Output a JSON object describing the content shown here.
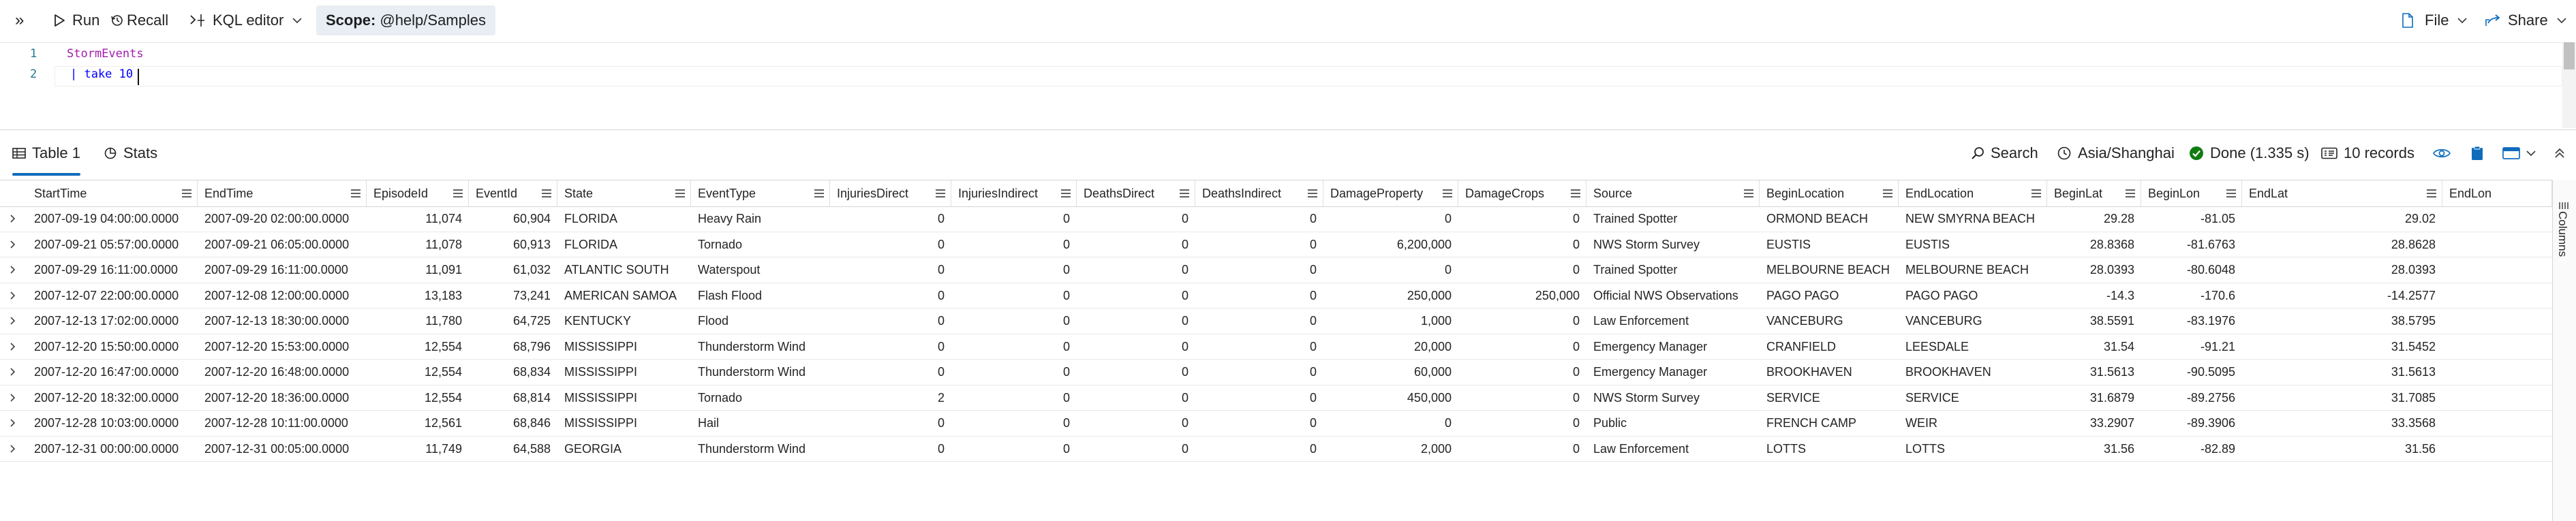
{
  "toolbar": {
    "expand_glyph": "»",
    "run_label": "Run",
    "recall_label": "Recall",
    "editor_label": "KQL editor",
    "scope_label": "Scope:",
    "scope_value": "@help/Samples",
    "file_label": "File",
    "share_label": "Share"
  },
  "editor": {
    "lines": [
      {
        "number": "1",
        "text": "StormEvents"
      },
      {
        "number": "2",
        "text": "| take 10"
      }
    ]
  },
  "results": {
    "tabs": [
      {
        "label": "Table 1",
        "active": true
      },
      {
        "label": "Stats",
        "active": false
      }
    ],
    "search_label": "Search",
    "timezone_label": "Asia/Shanghai",
    "status_label": "Done (1.335 s)",
    "records_label": "10 records",
    "side_panel_label": "Columns"
  },
  "table": {
    "columns": [
      "StartTime",
      "EndTime",
      "EpisodeId",
      "EventId",
      "State",
      "EventType",
      "InjuriesDirect",
      "InjuriesIndirect",
      "DeathsDirect",
      "DeathsIndirect",
      "DamageProperty",
      "DamageCrops",
      "Source",
      "BeginLocation",
      "EndLocation",
      "BeginLat",
      "BeginLon",
      "EndLat",
      "EndLon"
    ],
    "rows": [
      [
        "2007-09-19 04:00:00.0000",
        "2007-09-20 02:00:00.0000",
        "11,074",
        "60,904",
        "FLORIDA",
        "Heavy Rain",
        "0",
        "0",
        "0",
        "0",
        "0",
        "0",
        "Trained Spotter",
        "ORMOND BEACH",
        "NEW SMYRNA BEACH",
        "29.28",
        "-81.05",
        "29.02",
        ""
      ],
      [
        "2007-09-21 05:57:00.0000",
        "2007-09-21 06:05:00.0000",
        "11,078",
        "60,913",
        "FLORIDA",
        "Tornado",
        "0",
        "0",
        "0",
        "0",
        "6,200,000",
        "0",
        "NWS Storm Survey",
        "EUSTIS",
        "EUSTIS",
        "28.8368",
        "-81.6763",
        "28.8628",
        ""
      ],
      [
        "2007-09-29 16:11:00.0000",
        "2007-09-29 16:11:00.0000",
        "11,091",
        "61,032",
        "ATLANTIC SOUTH",
        "Waterspout",
        "0",
        "0",
        "0",
        "0",
        "0",
        "0",
        "Trained Spotter",
        "MELBOURNE BEACH",
        "MELBOURNE BEACH",
        "28.0393",
        "-80.6048",
        "28.0393",
        ""
      ],
      [
        "2007-12-07 22:00:00.0000",
        "2007-12-08 12:00:00.0000",
        "13,183",
        "73,241",
        "AMERICAN SAMOA",
        "Flash Flood",
        "0",
        "0",
        "0",
        "0",
        "250,000",
        "250,000",
        "Official NWS Observations",
        "PAGO PAGO",
        "PAGO PAGO",
        "-14.3",
        "-170.6",
        "-14.2577",
        ""
      ],
      [
        "2007-12-13 17:02:00.0000",
        "2007-12-13 18:30:00.0000",
        "11,780",
        "64,725",
        "KENTUCKY",
        "Flood",
        "0",
        "0",
        "0",
        "0",
        "1,000",
        "0",
        "Law Enforcement",
        "VANCEBURG",
        "VANCEBURG",
        "38.5591",
        "-83.1976",
        "38.5795",
        ""
      ],
      [
        "2007-12-20 15:50:00.0000",
        "2007-12-20 15:53:00.0000",
        "12,554",
        "68,796",
        "MISSISSIPPI",
        "Thunderstorm Wind",
        "0",
        "0",
        "0",
        "0",
        "20,000",
        "0",
        "Emergency Manager",
        "CRANFIELD",
        "LEESDALE",
        "31.54",
        "-91.21",
        "31.5452",
        ""
      ],
      [
        "2007-12-20 16:47:00.0000",
        "2007-12-20 16:48:00.0000",
        "12,554",
        "68,834",
        "MISSISSIPPI",
        "Thunderstorm Wind",
        "0",
        "0",
        "0",
        "0",
        "60,000",
        "0",
        "Emergency Manager",
        "BROOKHAVEN",
        "BROOKHAVEN",
        "31.5613",
        "-90.5095",
        "31.5613",
        ""
      ],
      [
        "2007-12-20 18:32:00.0000",
        "2007-12-20 18:36:00.0000",
        "12,554",
        "68,814",
        "MISSISSIPPI",
        "Tornado",
        "2",
        "0",
        "0",
        "0",
        "450,000",
        "0",
        "NWS Storm Survey",
        "SERVICE",
        "SERVICE",
        "31.6879",
        "-89.2756",
        "31.7085",
        ""
      ],
      [
        "2007-12-28 10:03:00.0000",
        "2007-12-28 10:11:00.0000",
        "12,561",
        "68,846",
        "MISSISSIPPI",
        "Hail",
        "0",
        "0",
        "0",
        "0",
        "0",
        "0",
        "Public",
        "FRENCH CAMP",
        "WEIR",
        "33.2907",
        "-89.3906",
        "33.3568",
        ""
      ],
      [
        "2007-12-31 00:00:00.0000",
        "2007-12-31 00:05:00.0000",
        "11,749",
        "64,588",
        "GEORGIA",
        "Thunderstorm Wind",
        "0",
        "0",
        "0",
        "0",
        "2,000",
        "0",
        "Law Enforcement",
        "LOTTS",
        "LOTTS",
        "31.56",
        "-82.89",
        "31.56",
        ""
      ]
    ]
  }
}
